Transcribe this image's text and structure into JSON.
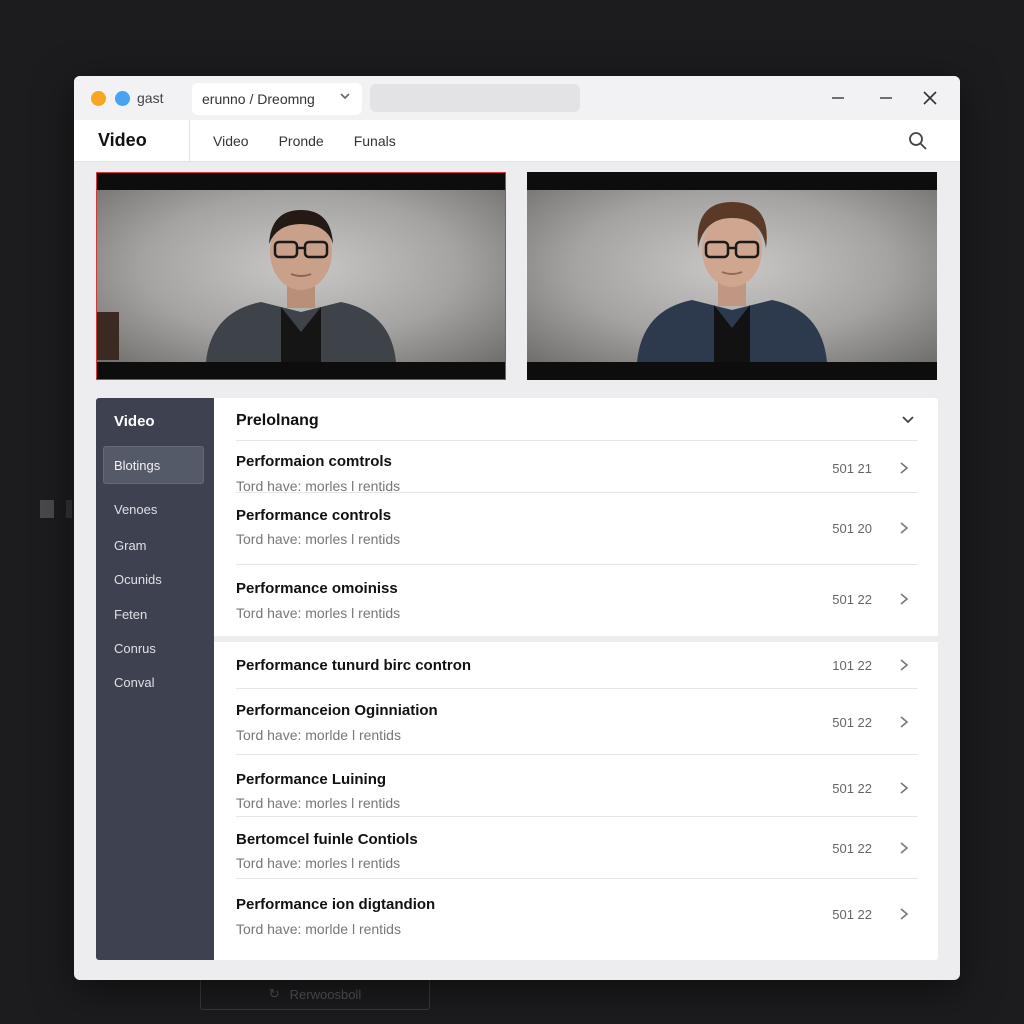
{
  "window": {
    "app_name": "gast",
    "tab_label": "erunno / Dreomng",
    "address_value": ""
  },
  "nav": {
    "brand": "Video",
    "links": [
      "Video",
      "Pronde",
      "Funals"
    ]
  },
  "sidebar": {
    "title": "Video",
    "active_item": "Blotings",
    "items": [
      "Venoes",
      "Gram",
      "Ocunids",
      "Feten",
      "Conrus",
      "Conval"
    ]
  },
  "section": {
    "title": "Prelolnang"
  },
  "list_top": [
    {
      "title": "Performaion comtrols",
      "subtitle": "Tord have: morles l rentids",
      "value": "501 21"
    },
    {
      "title": "Performance controls",
      "subtitle": "Tord have: morles l rentids",
      "value": "501 20"
    },
    {
      "title": "Performance omoiniss",
      "subtitle": "Tord have: morles l rentids",
      "value": "501 22"
    }
  ],
  "list_bottom": [
    {
      "title": "Performance tunurd birc contron",
      "subtitle": "",
      "value": "101 22"
    },
    {
      "title": "Performanceion Oginniation",
      "subtitle": "Tord have: morlde l rentids",
      "value": "501 22"
    },
    {
      "title": "Performance Luining",
      "subtitle": "Tord have: morles l rentids",
      "value": "501 22"
    },
    {
      "title": "Bertomcel fuinle Contiols",
      "subtitle": "Tord have: morles l rentids",
      "value": "501 22"
    },
    {
      "title": "Performance ion digtandion",
      "subtitle": "Tord have: morlde l rentids",
      "value": "501 22"
    }
  ],
  "background_button": "Rerwoosboll",
  "icons": {
    "search": "search-icon",
    "chevron_down": "chevron-down-icon",
    "chevron_right": "chevron-right-icon",
    "minimize": "minimize-icon",
    "close": "close-icon"
  },
  "colors": {
    "sidebar_bg": "#3e4250",
    "selected_video_border": "#d13a3a",
    "dot_orange": "#f5a623",
    "dot_blue": "#4aa3f0"
  }
}
